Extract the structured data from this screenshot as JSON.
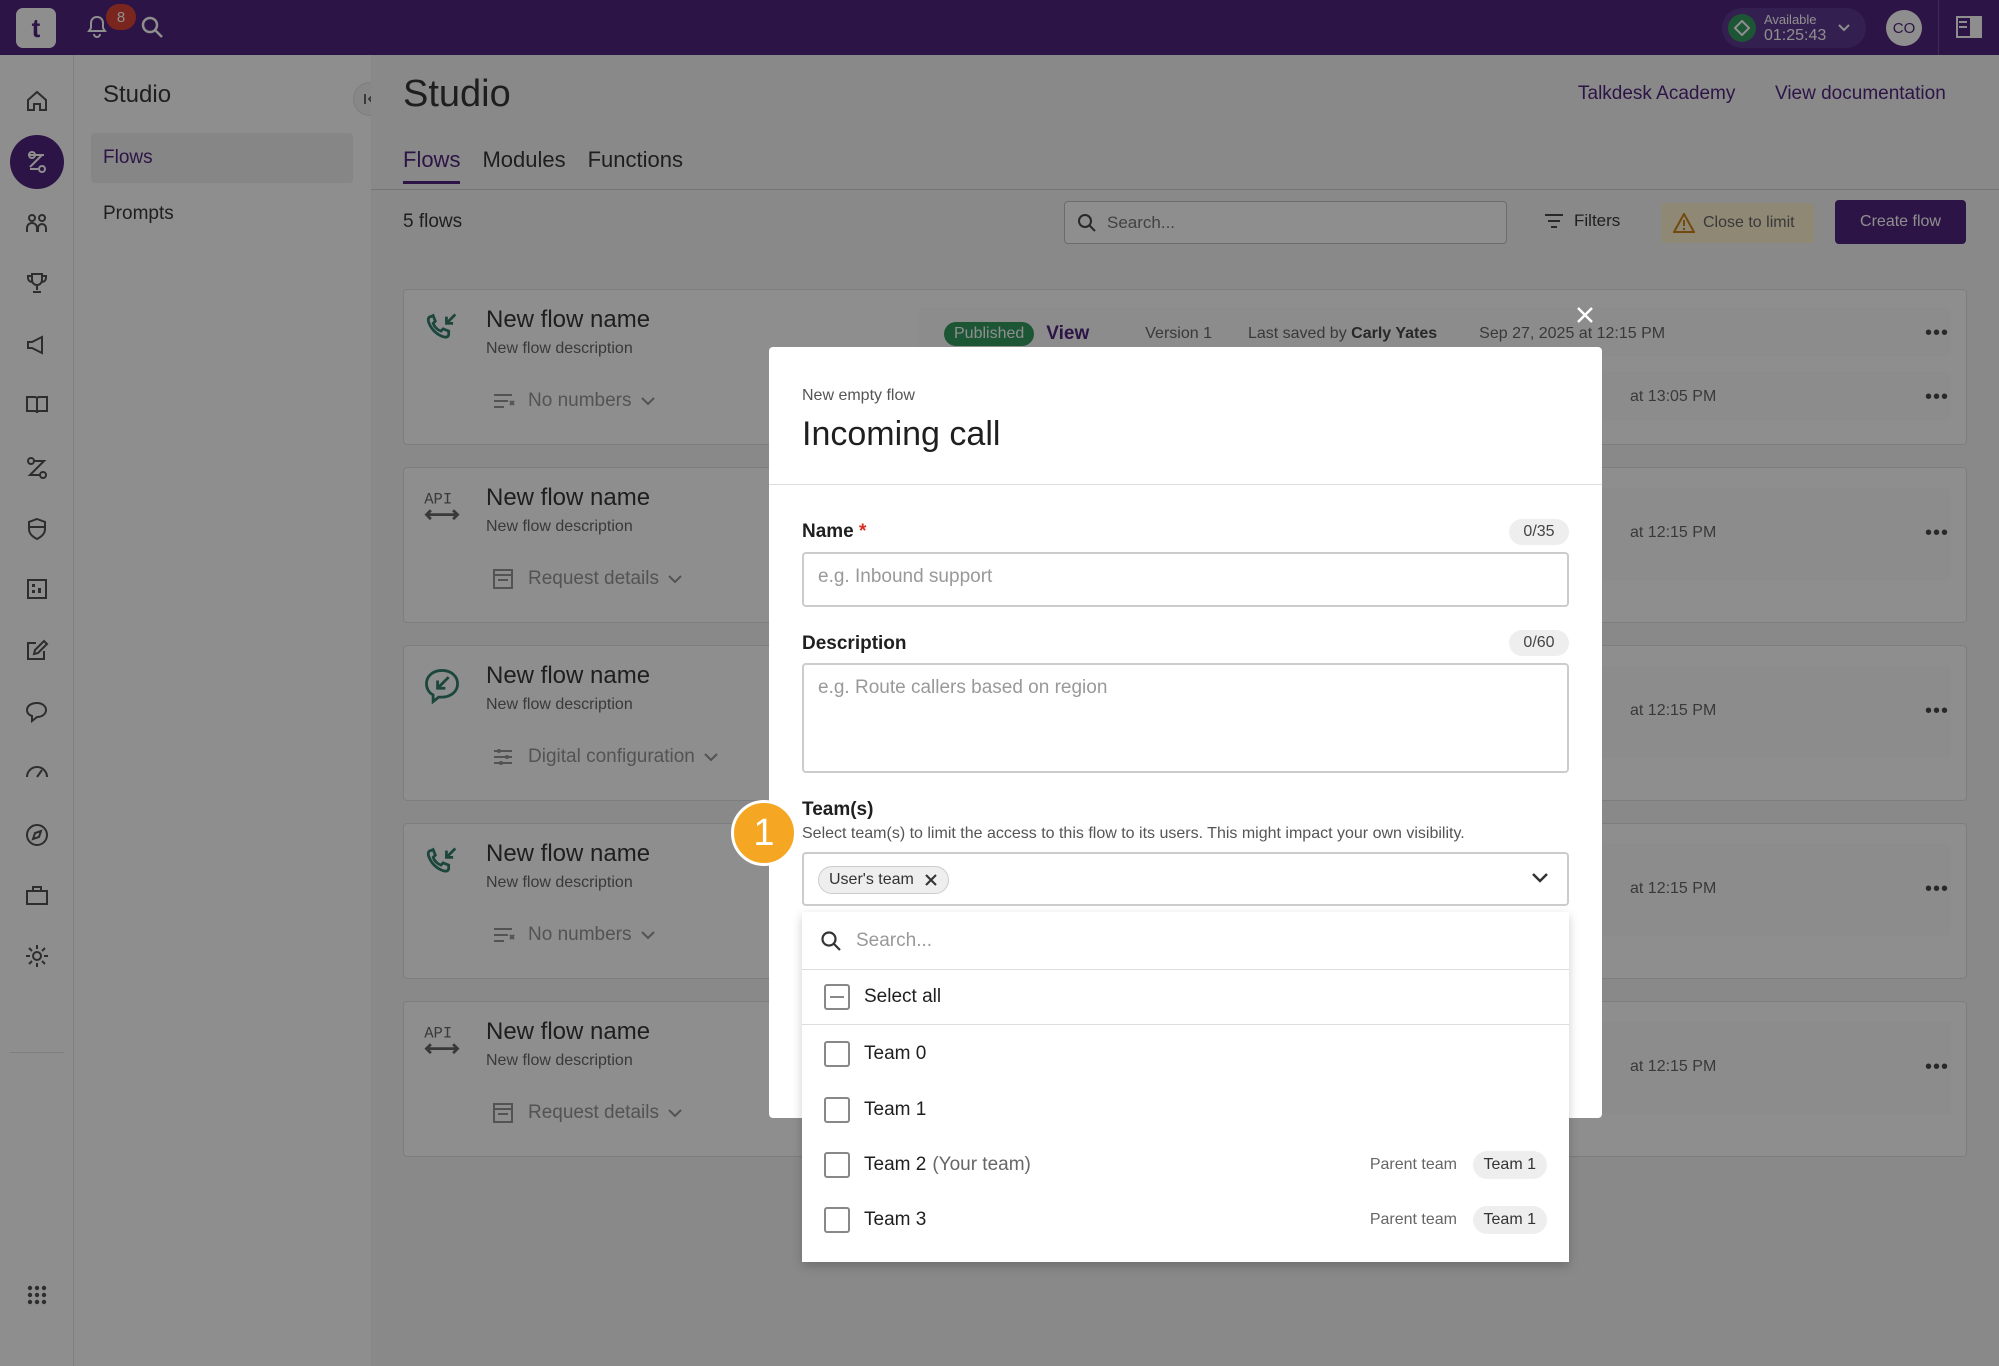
{
  "topbar": {
    "logo": "t",
    "notification_count": "8",
    "status": {
      "label": "Available",
      "timer": "01:25:43"
    },
    "avatar": "CO"
  },
  "rail": {
    "icons": [
      "home-icon",
      "studio-icon",
      "people-icon",
      "trophy-icon",
      "megaphone-icon",
      "book-icon",
      "flows-icon",
      "shield-icon",
      "reports-icon",
      "edit-icon",
      "chat-icon",
      "gauge-icon",
      "compass-icon",
      "briefcase-icon",
      "gear-icon",
      "apps-grid-icon"
    ],
    "active": "studio-icon"
  },
  "studio_nav": {
    "title": "Studio",
    "items": [
      {
        "label": "Flows",
        "active": true
      },
      {
        "label": "Prompts",
        "active": false
      }
    ]
  },
  "main": {
    "title": "Studio",
    "links": {
      "academy": "Talkdesk Academy",
      "docs": "View documentation"
    },
    "tabs": [
      {
        "label": "Flows",
        "active": true
      },
      {
        "label": "Modules"
      },
      {
        "label": "Functions"
      }
    ],
    "count": "5 flows",
    "search_placeholder": "Search...",
    "filters": "Filters",
    "warning": "Close to limit",
    "create": "Create flow",
    "published": {
      "badge": "Published",
      "view": "View",
      "version": "Version 1",
      "saved_by_label": "Last saved by",
      "saved_by_user": "Carly Yates",
      "date": "Sep 27, 2025 at 12:15 PM"
    },
    "flows": [
      {
        "name": "New flow name",
        "desc": "New flow description",
        "meta": "No numbers",
        "icon": "phone-incoming-icon",
        "date": "at 13:05 PM"
      },
      {
        "name": "New flow name",
        "desc": "New flow description",
        "meta": "Request details",
        "icon": "api-icon",
        "date": "at 12:15 PM"
      },
      {
        "name": "New flow name",
        "desc": "New flow description",
        "meta": "Digital configuration",
        "icon": "chat-incoming-icon",
        "date": "at 12:15 PM"
      },
      {
        "name": "New flow name",
        "desc": "New flow description",
        "meta": "No numbers",
        "icon": "phone-incoming-icon",
        "date": "at 12:15 PM"
      },
      {
        "name": "New flow name",
        "desc": "New flow description",
        "meta": "Request details",
        "icon": "api-icon",
        "date": "at 12:15 PM"
      }
    ],
    "more": "•••"
  },
  "modal": {
    "subtitle": "New empty flow",
    "title": "Incoming call",
    "name": {
      "label": "Name",
      "required": "*",
      "counter": "0/35",
      "placeholder": "e.g. Inbound support"
    },
    "description": {
      "label": "Description",
      "counter": "0/60",
      "placeholder": "e.g. Route callers based on region"
    },
    "teams": {
      "label": "Team(s)",
      "help": "Select team(s) to limit the access to this flow to its users. This might impact your own visibility.",
      "chip": "User's team"
    },
    "dropdown": {
      "search_placeholder": "Search...",
      "select_all": "Select all",
      "options": [
        {
          "label": "Team 0"
        },
        {
          "label": "Team 1"
        },
        {
          "label": "Team 2",
          "suffix": "(Your team)",
          "parent_label": "Parent team",
          "parent": "Team 1"
        },
        {
          "label": "Team 3",
          "parent_label": "Parent team",
          "parent": "Team 1"
        }
      ]
    }
  },
  "step_marker": "1"
}
